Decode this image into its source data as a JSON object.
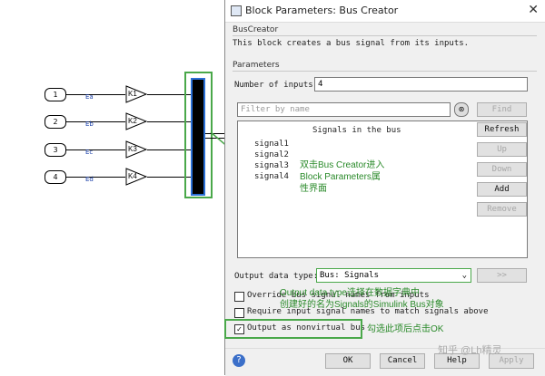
{
  "model": {
    "inports": [
      "1",
      "2",
      "3",
      "4"
    ],
    "signals": [
      "Ea",
      "Eb",
      "Ec",
      "Ed"
    ],
    "gains": [
      "K1",
      "K2",
      "K3",
      "K4"
    ]
  },
  "dialog": {
    "title": "Block Parameters: Bus Creator",
    "close_glyph": "✕",
    "block_name": "BusCreator",
    "description": "This block creates a bus signal from its inputs.",
    "params_header": "Parameters",
    "num_inputs_label": "Number of inputs:",
    "num_inputs_value": "4",
    "filter_placeholder": "Filter by name",
    "signals_header": "Signals in the bus",
    "signals": [
      "signal1",
      "signal2",
      "signal3",
      "signal4"
    ],
    "buttons": {
      "find": "Find",
      "refresh": "Refresh",
      "up": "Up",
      "down": "Down",
      "add": "Add",
      "remove": "Remove",
      "more": ">>",
      "ok": "OK",
      "cancel": "Cancel",
      "help": "Help",
      "apply": "Apply"
    },
    "output_type_label": "Output data type:",
    "output_type_value": "Bus: Signals",
    "options": {
      "override": "Override bus signal names from inputs",
      "require": "Require input signal names to match signals above",
      "nonvirtual": "Output as nonvirtual bus"
    },
    "nonvirtual_checked": "✓"
  },
  "annotations": {
    "a1_line1": "双击Bus Creator进入",
    "a1_line2": "Block Parameters属",
    "a1_line3": "性界面",
    "a2_line1": "Output data type选择在数据字典中",
    "a2_line2": "创建好的名为Signals的Simulink Bus对象",
    "a3": "勾选此项后点击OK"
  },
  "watermark": "知乎 @Lh精灵",
  "colors": {
    "annotation": "#2a8a2a",
    "bus_border": "#2a6fd6",
    "signal_label": "#1a3fa8"
  }
}
